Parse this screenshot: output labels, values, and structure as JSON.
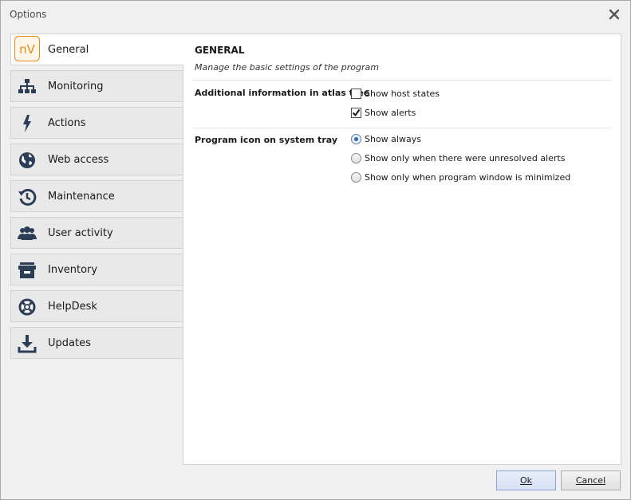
{
  "window": {
    "title": "Options"
  },
  "sidebar": {
    "items": [
      {
        "label": "General",
        "icon": "nv-logo-icon",
        "active": true
      },
      {
        "label": "Monitoring",
        "icon": "hierarchy-icon"
      },
      {
        "label": "Actions",
        "icon": "lightning-icon"
      },
      {
        "label": "Web access",
        "icon": "globe-icon"
      },
      {
        "label": "Maintenance",
        "icon": "history-icon"
      },
      {
        "label": "User activity",
        "icon": "users-icon"
      },
      {
        "label": "Inventory",
        "icon": "archive-icon"
      },
      {
        "label": "HelpDesk",
        "icon": "lifebuoy-icon"
      },
      {
        "label": "Updates",
        "icon": "download-icon"
      }
    ],
    "logo_text": "nV"
  },
  "main": {
    "title": "GENERAL",
    "subtitle": "Manage the basic settings of the program",
    "atlas": {
      "label": "Additional information in atlas tree",
      "options": [
        {
          "label": "Show host states",
          "checked": false
        },
        {
          "label": "Show alerts",
          "checked": true
        }
      ]
    },
    "tray": {
      "label": "Program icon on system tray",
      "options": [
        {
          "label": "Show always",
          "selected": true
        },
        {
          "label": "Show only when there were unresolved alerts",
          "selected": false
        },
        {
          "label": "Show only when program window is minimized",
          "selected": false
        }
      ]
    }
  },
  "footer": {
    "ok_label": "Ok",
    "cancel_label": "Cancel"
  },
  "colors": {
    "accent": "#3b64b0",
    "logo_orange": "#e8891c",
    "icon_dark": "#2c3e56"
  }
}
